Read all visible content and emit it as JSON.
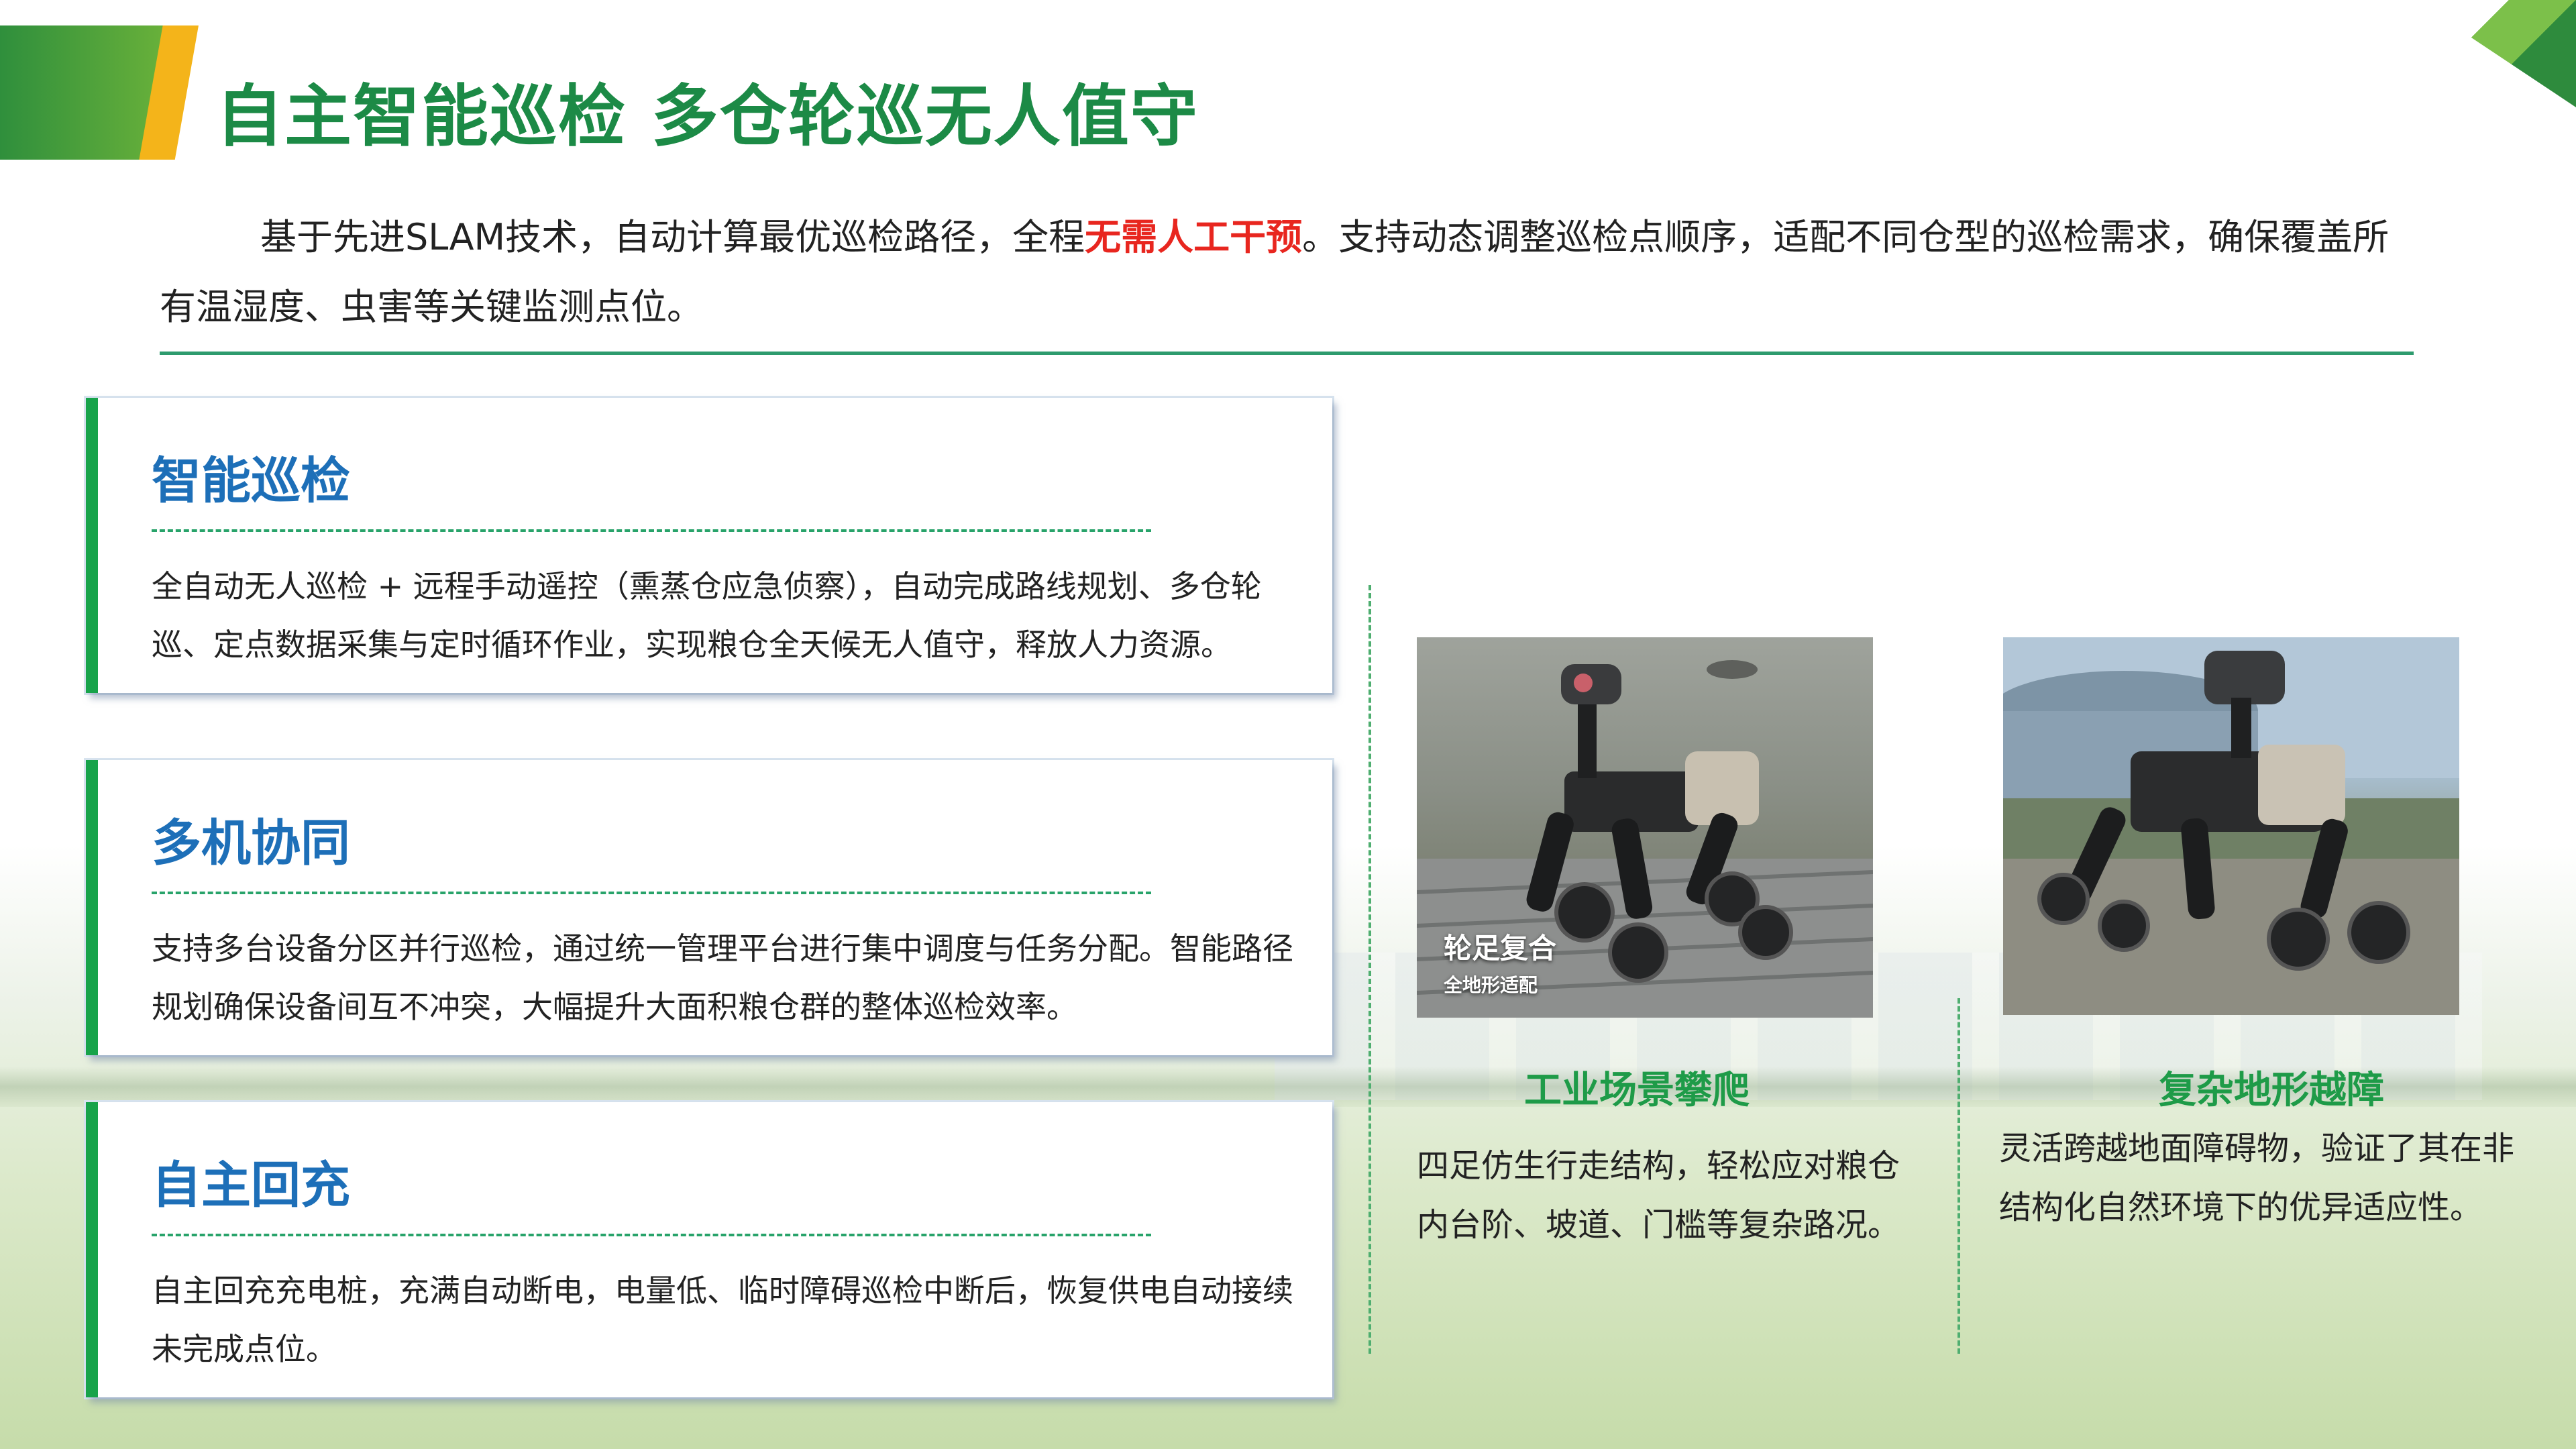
{
  "header": {
    "title": "自主智能巡检 多仓轮巡无人值守"
  },
  "intro": {
    "part1": "基于先进SLAM技术，自动计算最优巡检路径，全程",
    "highlight": "无需人工干预",
    "part2": "。支持动态调整巡检点顺序，适配不同仓型的巡检需求，确保覆盖所有温湿度、虫害等关键监测点位。"
  },
  "cards": [
    {
      "title": "智能巡检",
      "text": "全自动无人巡检 + 远程手动遥控（熏蒸仓应急侦察），自动完成路线规划、多仓轮巡、定点数据采集与定时循环作业，实现粮仓全天候无人值守，释放人力资源。"
    },
    {
      "title": "多机协同",
      "text": "支持多台设备分区并行巡检，通过统一管理平台进行集中调度与任务分配。智能路径规划确保设备间互不冲突，大幅提升大面积粮仓群的整体巡检效率。"
    },
    {
      "title": "自主回充",
      "text": "自主回充充电桩，充满自动断电，电量低、临时障碍巡检中断后，恢复供电自动接续未完成点位。"
    }
  ],
  "photos": [
    {
      "badge_title": "轮足复合",
      "badge_sub": "全地形适配",
      "caption_title": "工业场景攀爬",
      "caption_text": "四足仿生行走结构，轻松应对粮仓内台阶、坡道、门槛等复杂路况。"
    },
    {
      "caption_title": "复杂地形越障",
      "caption_text": "灵活跨越地面障碍物，验证了其在非结构化自然环境下的优异适应性。"
    }
  ],
  "colors": {
    "title_green": "#1c8a46",
    "card_title_blue": "#1d6fb8",
    "highlight_red": "#e8261f",
    "accent_green": "#17a34a",
    "accent_orange": "#f4b41a"
  }
}
